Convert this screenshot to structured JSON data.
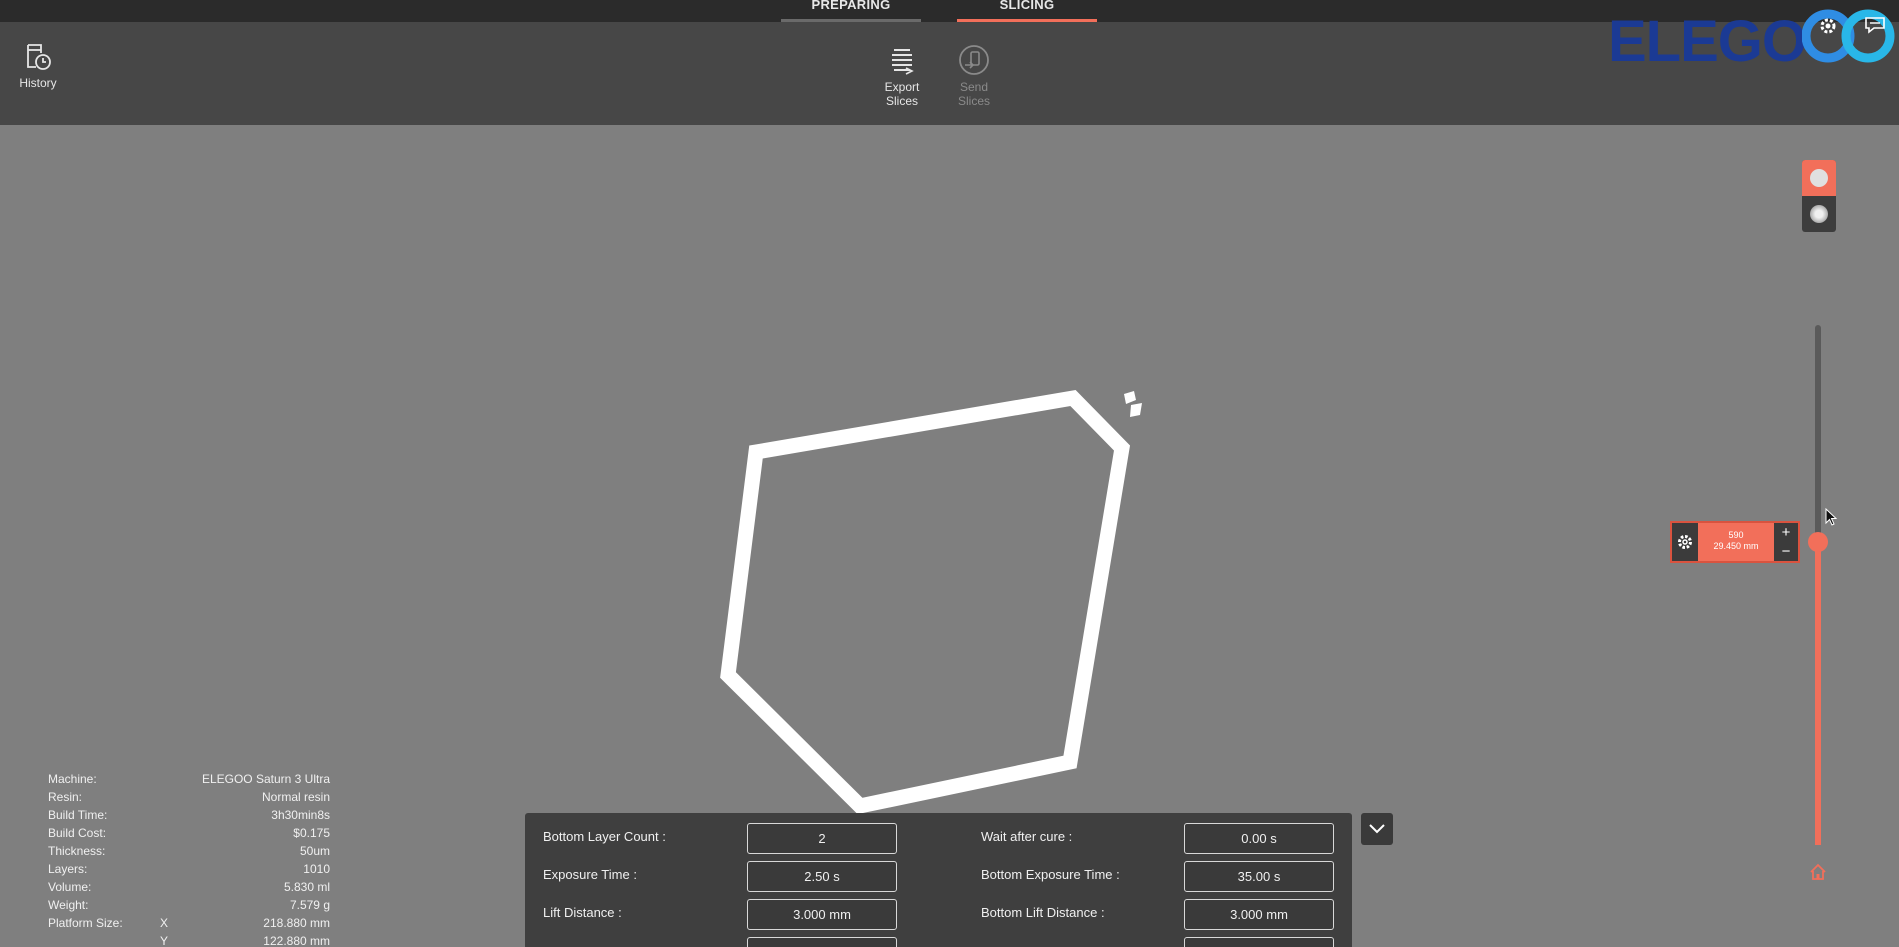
{
  "tabs": {
    "preparing": "PREPARING",
    "slicing": "SLICING"
  },
  "toolbar": {
    "history_label": "History",
    "export_line1": "Export",
    "export_line2": "Slices",
    "send_line1": "Send",
    "send_line2": "Slices"
  },
  "brand": {
    "logo_text": "ELEGO",
    "accent": "#f26f5a",
    "logo_color": "#1b3a94"
  },
  "layer_control": {
    "layer": "590",
    "height": "29.450 mm",
    "plus": "+",
    "minus": "−"
  },
  "info": {
    "rows": [
      {
        "key": "Machine:",
        "value": "ELEGOO Saturn 3 Ultra"
      },
      {
        "key": "Resin:",
        "value": "Normal resin"
      },
      {
        "key": "Build Time:",
        "value": "3h30min8s"
      },
      {
        "key": "Build Cost:",
        "value": "$0.175"
      },
      {
        "key": "Thickness:",
        "value": "50um"
      },
      {
        "key": "Layers:",
        "value": "1010"
      },
      {
        "key": "Volume:",
        "value": "5.830 ml"
      },
      {
        "key": "Weight:",
        "value": "7.579 g"
      }
    ],
    "platform_label": "Platform Size:",
    "platform_x_axis": "X",
    "platform_x": "218.880 mm",
    "platform_y_axis": "Y",
    "platform_y": "122.880 mm"
  },
  "settings": {
    "bottom_layer_count_label": "Bottom Layer Count :",
    "bottom_layer_count": "2",
    "wait_after_cure_label": "Wait after cure :",
    "wait_after_cure": "0.00 s",
    "exposure_time_label": "Exposure Time :",
    "exposure_time": "2.50 s",
    "bottom_exposure_time_label": "Bottom Exposure Time :",
    "bottom_exposure_time": "35.00 s",
    "lift_distance_label": "Lift Distance :",
    "lift_distance": "3.000 mm",
    "bottom_lift_distance_label": "Bottom Lift Distance :",
    "bottom_lift_distance": "3.000 mm"
  }
}
